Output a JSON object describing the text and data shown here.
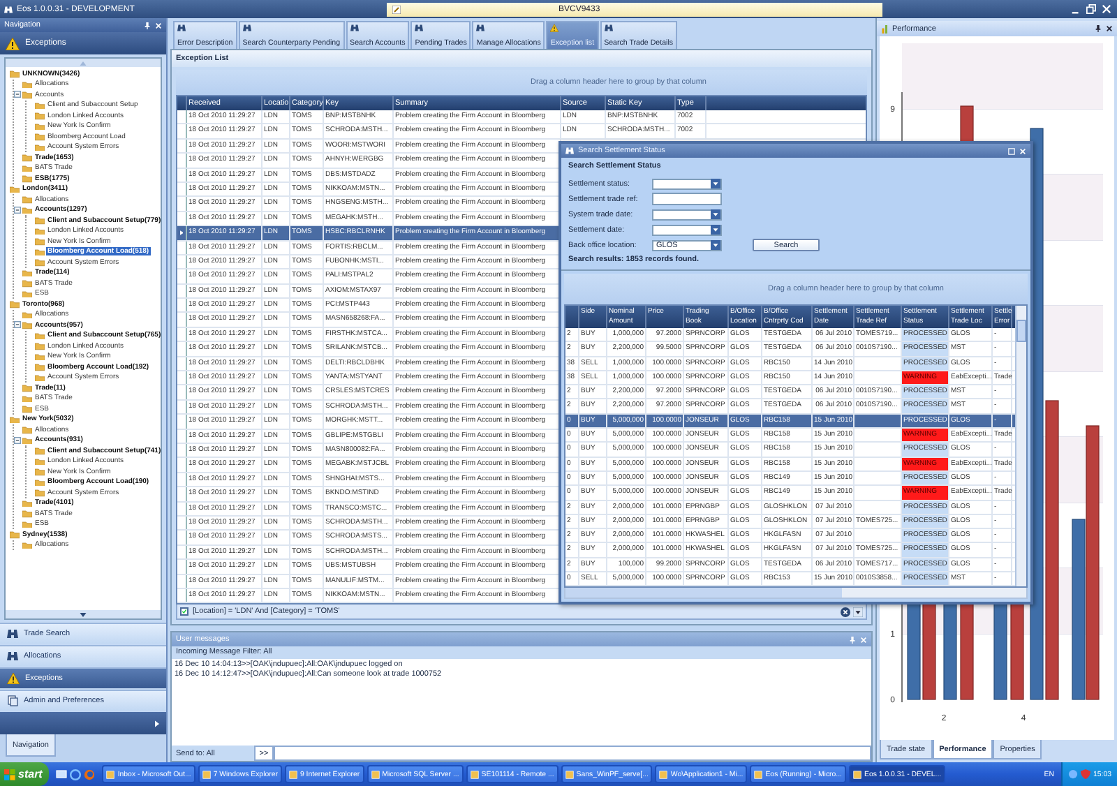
{
  "window": {
    "title": "Eos 1.0.0.31 - DEVELOPMENT",
    "field_value": "BVCV9433"
  },
  "navigation": {
    "title": "Navigation",
    "section": "Exceptions",
    "tree": [
      {
        "label": "UNKNOWN(3426)",
        "bold": true,
        "selected": false,
        "children": [
          {
            "label": "Allocations",
            "bold": false,
            "selected": false
          },
          {
            "label": "Accounts",
            "bold": false,
            "selected": false,
            "expanded": true,
            "children": [
              {
                "label": "Client and Subaccount Setup",
                "bold": false,
                "selected": false
              },
              {
                "label": "London Linked Accounts",
                "bold": false,
                "selected": false
              },
              {
                "label": "New York Is Confirm",
                "bold": false,
                "selected": false
              },
              {
                "label": "Bloomberg Account Load",
                "bold": false,
                "selected": false
              },
              {
                "label": "Account System Errors",
                "bold": false,
                "selected": false
              }
            ]
          },
          {
            "label": "Trade(1653)",
            "bold": true,
            "selected": false
          },
          {
            "label": "BATS Trade",
            "bold": false,
            "selected": false
          },
          {
            "label": "ESB(1775)",
            "bold": true,
            "selected": false
          }
        ]
      },
      {
        "label": "London(3411)",
        "bold": true,
        "selected": false,
        "children": [
          {
            "label": "Allocations",
            "bold": false,
            "selected": false
          },
          {
            "label": "Accounts(1297)",
            "bold": true,
            "selected": false,
            "expanded": true,
            "children": [
              {
                "label": "Client and Subaccount Setup(779)",
                "bold": true,
                "selected": false
              },
              {
                "label": "London Linked Accounts",
                "bold": false,
                "selected": false
              },
              {
                "label": "New York Is Confirm",
                "bold": false,
                "selected": false
              },
              {
                "label": "Bloomberg Account Load(518)",
                "bold": true,
                "selected": true
              },
              {
                "label": "Account System Errors",
                "bold": false,
                "selected": false
              }
            ]
          },
          {
            "label": "Trade(114)",
            "bold": true,
            "selected": false
          },
          {
            "label": "BATS Trade",
            "bold": false,
            "selected": false
          },
          {
            "label": "ESB",
            "bold": false,
            "selected": false
          }
        ]
      },
      {
        "label": "Toronto(968)",
        "bold": true,
        "selected": false,
        "children": [
          {
            "label": "Allocations",
            "bold": false,
            "selected": false
          },
          {
            "label": "Accounts(957)",
            "bold": true,
            "selected": false,
            "expanded": true,
            "children": [
              {
                "label": "Client and Subaccount Setup(765)",
                "bold": true,
                "selected": false
              },
              {
                "label": "London Linked Accounts",
                "bold": false,
                "selected": false
              },
              {
                "label": "New York Is Confirm",
                "bold": false,
                "selected": false
              },
              {
                "label": "Bloomberg Account Load(192)",
                "bold": true,
                "selected": false
              },
              {
                "label": "Account System Errors",
                "bold": false,
                "selected": false
              }
            ]
          },
          {
            "label": "Trade(11)",
            "bold": true,
            "selected": false
          },
          {
            "label": "BATS Trade",
            "bold": false,
            "selected": false
          },
          {
            "label": "ESB",
            "bold": false,
            "selected": false
          }
        ]
      },
      {
        "label": "New York(5032)",
        "bold": true,
        "selected": false,
        "children": [
          {
            "label": "Allocations",
            "bold": false,
            "selected": false
          },
          {
            "label": "Accounts(931)",
            "bold": true,
            "selected": false,
            "expanded": true,
            "children": [
              {
                "label": "Client and Subaccount Setup(741)",
                "bold": true,
                "selected": false
              },
              {
                "label": "London Linked Accounts",
                "bold": false,
                "selected": false
              },
              {
                "label": "New York Is Confirm",
                "bold": false,
                "selected": false
              },
              {
                "label": "Bloomberg Account Load(190)",
                "bold": true,
                "selected": false
              },
              {
                "label": "Account System Errors",
                "bold": false,
                "selected": false
              }
            ]
          },
          {
            "label": "Trade(4101)",
            "bold": true,
            "selected": false
          },
          {
            "label": "BATS Trade",
            "bold": false,
            "selected": false
          },
          {
            "label": "ESB",
            "bold": false,
            "selected": false
          }
        ]
      },
      {
        "label": "Sydney(1538)",
        "bold": true,
        "selected": false,
        "children": [
          {
            "label": "Allocations",
            "bold": false,
            "selected": false
          }
        ]
      }
    ],
    "buttons": [
      {
        "label": "Trade Search",
        "kind": "search",
        "selected": false
      },
      {
        "label": "Allocations",
        "kind": "search",
        "selected": false
      },
      {
        "label": "Exceptions",
        "kind": "warning",
        "selected": true
      },
      {
        "label": "Admin and Preferences",
        "kind": "admin",
        "selected": false
      }
    ],
    "tab": "Navigation"
  },
  "tabs": [
    {
      "label": "Error Description",
      "selected": false
    },
    {
      "label": "Search Counterparty Pending",
      "selected": false
    },
    {
      "label": "Search Accounts",
      "selected": false
    },
    {
      "label": "Pending Trades",
      "selected": false
    },
    {
      "label": "Manage Allocations",
      "selected": false
    },
    {
      "label": "Exception list",
      "selected": true
    },
    {
      "label": "Search Trade Details",
      "selected": false
    }
  ],
  "exception_list": {
    "title": "Exception List",
    "group_hint": "Drag a column header here to group by that column",
    "columns": [
      "Received",
      "Locatio",
      "Category",
      "Key",
      "Summary",
      "Source",
      "Static Key",
      "Type"
    ],
    "rows": [
      {
        "cells": [
          "18 Oct 2010 11:29:27",
          "LDN",
          "TOMS",
          "BNP:MSTBNHK",
          "Problem creating the Firm Account in Bloomberg",
          "LDN",
          "BNP:MSTBNHK",
          "7002"
        ],
        "selected": false
      },
      {
        "cells": [
          "18 Oct 2010 11:29:27",
          "LDN",
          "TOMS",
          "SCHRODA:MSTH...",
          "Problem creating the Firm Account in Bloomberg",
          "LDN",
          "SCHRODA:MSTH...",
          "7002"
        ],
        "selected": false
      },
      {
        "cells": [
          "18 Oct 2010 11:29:27",
          "LDN",
          "TOMS",
          "WOORI:MSTWORI",
          "Problem creating the Firm Account in Bloomberg"
        ],
        "selected": false
      },
      {
        "cells": [
          "18 Oct 2010 11:29:27",
          "LDN",
          "TOMS",
          "AHNYH:WERGBG",
          "Problem creating the Firm Account in Bloomberg"
        ],
        "selected": false
      },
      {
        "cells": [
          "18 Oct 2010 11:29:27",
          "LDN",
          "TOMS",
          "DBS:MSTDADZ",
          "Problem creating the Firm Account in Bloomberg"
        ],
        "selected": false
      },
      {
        "cells": [
          "18 Oct 2010 11:29:27",
          "LDN",
          "TOMS",
          "NIKKOAM:MSTN...",
          "Problem creating the Firm Account in Bloomberg"
        ],
        "selected": false
      },
      {
        "cells": [
          "18 Oct 2010 11:29:27",
          "LDN",
          "TOMS",
          "HNGSENG:MSTH...",
          "Problem creating the Firm Account in Bloomberg"
        ],
        "selected": false
      },
      {
        "cells": [
          "18 Oct 2010 11:29:27",
          "LDN",
          "TOMS",
          "MEGAHK:MSTH...",
          "Problem creating the Firm Account in Bloomberg"
        ],
        "selected": false
      },
      {
        "cells": [
          "18 Oct 2010 11:29:27",
          "LDN",
          "TOMS",
          "HSBC:RBCLRNHK",
          "Problem creating the Firm Account in Bloomberg"
        ],
        "selected": true
      },
      {
        "cells": [
          "18 Oct 2010 11:29:27",
          "LDN",
          "TOMS",
          "FORTIS:RBCLM...",
          "Problem creating the Firm Account in Bloomberg"
        ],
        "selected": false
      },
      {
        "cells": [
          "18 Oct 2010 11:29:27",
          "LDN",
          "TOMS",
          "FUBONHK:MSTI...",
          "Problem creating the Firm Account in Bloomberg"
        ],
        "selected": false
      },
      {
        "cells": [
          "18 Oct 2010 11:29:27",
          "LDN",
          "TOMS",
          "PALI:MSTPAL2",
          "Problem creating the Firm Account in Bloomberg"
        ],
        "selected": false
      },
      {
        "cells": [
          "18 Oct 2010 11:29:27",
          "LDN",
          "TOMS",
          "AXIOM:MSTAX97",
          "Problem creating the Firm Account in Bloomberg"
        ],
        "selected": false
      },
      {
        "cells": [
          "18 Oct 2010 11:29:27",
          "LDN",
          "TOMS",
          "PCI:MSTP443",
          "Problem creating the Firm Account in Bloomberg"
        ],
        "selected": false
      },
      {
        "cells": [
          "18 Oct 2010 11:29:27",
          "LDN",
          "TOMS",
          "MASN658268:FA...",
          "Problem creating the Firm Account in Bloomberg"
        ],
        "selected": false
      },
      {
        "cells": [
          "18 Oct 2010 11:29:27",
          "LDN",
          "TOMS",
          "FIRSTHK:MSTCA...",
          "Problem creating the Firm Account in Bloomberg"
        ],
        "selected": false
      },
      {
        "cells": [
          "18 Oct 2010 11:29:27",
          "LDN",
          "TOMS",
          "SRILANK:MSTCB...",
          "Problem creating the Firm Account in Bloomberg"
        ],
        "selected": false
      },
      {
        "cells": [
          "18 Oct 2010 11:29:27",
          "LDN",
          "TOMS",
          "DELTI:RBCLDBHK",
          "Problem creating the Firm Account in Bloomberg"
        ],
        "selected": false
      },
      {
        "cells": [
          "18 Oct 2010 11:29:27",
          "LDN",
          "TOMS",
          "YANTA:MSTYANT",
          "Problem creating the Firm Account in Bloomberg"
        ],
        "selected": false
      },
      {
        "cells": [
          "18 Oct 2010 11:29:27",
          "LDN",
          "TOMS",
          "CRSLES:MSTCRES",
          "Problem creating the Firm Account in Bloomberg"
        ],
        "selected": false
      },
      {
        "cells": [
          "18 Oct 2010 11:29:27",
          "LDN",
          "TOMS",
          "SCHRODA:MSTH...",
          "Problem creating the Firm Account in Bloomberg"
        ],
        "selected": false
      },
      {
        "cells": [
          "18 Oct 2010 11:29:27",
          "LDN",
          "TOMS",
          "MORGHK:MSTT...",
          "Problem creating the Firm Account in Bloomberg"
        ],
        "selected": false
      },
      {
        "cells": [
          "18 Oct 2010 11:29:27",
          "LDN",
          "TOMS",
          "GBLIPE:MSTGBLI",
          "Problem creating the Firm Account in Bloomberg"
        ],
        "selected": false
      },
      {
        "cells": [
          "18 Oct 2010 11:29:27",
          "LDN",
          "TOMS",
          "MASN800082:FA...",
          "Problem creating the Firm Account in Bloomberg"
        ],
        "selected": false
      },
      {
        "cells": [
          "18 Oct 2010 11:29:27",
          "LDN",
          "TOMS",
          "MEGABK:MSTJCBL",
          "Problem creating the Firm Account in Bloomberg"
        ],
        "selected": false
      },
      {
        "cells": [
          "18 Oct 2010 11:29:27",
          "LDN",
          "TOMS",
          "SHNGHAI:MSTS...",
          "Problem creating the Firm Account in Bloomberg"
        ],
        "selected": false
      },
      {
        "cells": [
          "18 Oct 2010 11:29:27",
          "LDN",
          "TOMS",
          "BKNDO:MSTIND",
          "Problem creating the Firm Account in Bloomberg"
        ],
        "selected": false
      },
      {
        "cells": [
          "18 Oct 2010 11:29:27",
          "LDN",
          "TOMS",
          "TRANSCO:MSTC...",
          "Problem creating the Firm Account in Bloomberg"
        ],
        "selected": false
      },
      {
        "cells": [
          "18 Oct 2010 11:29:27",
          "LDN",
          "TOMS",
          "SCHRODA:MSTH...",
          "Problem creating the Firm Account in Bloomberg"
        ],
        "selected": false
      },
      {
        "cells": [
          "18 Oct 2010 11:29:27",
          "LDN",
          "TOMS",
          "SCHRODA:MSTS...",
          "Problem creating the Firm Account in Bloomberg"
        ],
        "selected": false
      },
      {
        "cells": [
          "18 Oct 2010 11:29:27",
          "LDN",
          "TOMS",
          "SCHRODA:MSTH...",
          "Problem creating the Firm Account in Bloomberg"
        ],
        "selected": false
      },
      {
        "cells": [
          "18 Oct 2010 11:29:27",
          "LDN",
          "TOMS",
          "UBS:MSTUBSH",
          "Problem creating the Firm Account in Bloomberg"
        ],
        "selected": false
      },
      {
        "cells": [
          "18 Oct 2010 11:29:27",
          "LDN",
          "TOMS",
          "MANULIF:MSTM...",
          "Problem creating the Firm Account in Bloomberg"
        ],
        "selected": false
      },
      {
        "cells": [
          "18 Oct 2010 11:29:27",
          "LDN",
          "TOMS",
          "NIKKOAM:MSTN...",
          "Problem creating the Firm Account in Bloomberg"
        ],
        "selected": false
      }
    ],
    "filter": {
      "checked": true,
      "text": "[Location] = 'LDN' And [Category] = 'TOMS'"
    }
  },
  "search_dialog": {
    "title": "Search Settlement Status",
    "heading": "Search Settlement Status",
    "fields": [
      {
        "label": "Settlement status:",
        "kind": "dropdown"
      },
      {
        "label": "Settlement trade ref:",
        "kind": "text"
      },
      {
        "label": "System trade date:",
        "kind": "dropdown"
      },
      {
        "label": "Settlement date:",
        "kind": "dropdown"
      },
      {
        "label": "Back office location:",
        "kind": "dropdown",
        "value": "GLOS"
      }
    ],
    "search_button": "Search",
    "results": "Search results: 1853 records found.",
    "group_hint": "Drag a column header here to group by that column",
    "columns": [
      "",
      "Side",
      "Nominal Amount",
      "Price",
      "Trading Book",
      "B/Office Location",
      "B/Office Cntrprty Cod",
      "Settlement Date",
      "Settlement Trade Ref",
      "Settlement Status",
      "Settlement Trade Loc",
      "Settle Error"
    ],
    "rows": [
      {
        "cells": [
          "2",
          "BUY",
          "1,000,000",
          "97.2000",
          "SPRNCORP",
          "GLOS",
          "TESTGEDA",
          "06 Jul 2010",
          "TOMES719...",
          "PROCESSED",
          "GLOS",
          "-"
        ],
        "warning": false,
        "selected": false
      },
      {
        "cells": [
          "2",
          "BUY",
          "2,200,000",
          "99.5000",
          "SPRNCORP",
          "GLOS",
          "TESTGEDA",
          "06 Jul 2010",
          "0010S7190...",
          "PROCESSED",
          "MST",
          "-"
        ],
        "warning": false,
        "selected": false
      },
      {
        "cells": [
          "38",
          "SELL",
          "1,000,000",
          "100.0000",
          "SPRNCORP",
          "GLOS",
          "RBC150",
          "14 Jun 2010",
          "",
          "PROCESSED",
          "GLOS",
          "-"
        ],
        "warning": false,
        "selected": false
      },
      {
        "cells": [
          "38",
          "SELL",
          "1,000,000",
          "100.0000",
          "SPRNCORP",
          "GLOS",
          "RBC150",
          "14 Jun 2010",
          "",
          "WARNING",
          "EabExcepti...",
          "Trade"
        ],
        "warning": true,
        "selected": false
      },
      {
        "cells": [
          "2",
          "BUY",
          "2,200,000",
          "97.2000",
          "SPRNCORP",
          "GLOS",
          "TESTGEDA",
          "06 Jul 2010",
          "0010S7190...",
          "PROCESSED",
          "MST",
          "-"
        ],
        "warning": false,
        "selected": false
      },
      {
        "cells": [
          "2",
          "BUY",
          "2,200,000",
          "97.2000",
          "SPRNCORP",
          "GLOS",
          "TESTGEDA",
          "06 Jul 2010",
          "0010S7190...",
          "PROCESSED",
          "MST",
          "-"
        ],
        "warning": false,
        "selected": false
      },
      {
        "cells": [
          "0",
          "BUY",
          "5,000,000",
          "100.0000",
          "JONSEUR",
          "GLOS",
          "RBC158",
          "15 Jun 2010",
          "",
          "PROCESSED",
          "GLOS",
          "-"
        ],
        "warning": false,
        "selected": true
      },
      {
        "cells": [
          "0",
          "BUY",
          "5,000,000",
          "100.0000",
          "JONSEUR",
          "GLOS",
          "RBC158",
          "15 Jun 2010",
          "",
          "WARNING",
          "EabExcepti...",
          "Trade"
        ],
        "warning": true,
        "selected": false
      },
      {
        "cells": [
          "0",
          "BUY",
          "5,000,000",
          "100.0000",
          "JONSEUR",
          "GLOS",
          "RBC158",
          "15 Jun 2010",
          "",
          "PROCESSED",
          "GLOS",
          "-"
        ],
        "warning": false,
        "selected": false
      },
      {
        "cells": [
          "0",
          "BUY",
          "5,000,000",
          "100.0000",
          "JONSEUR",
          "GLOS",
          "RBC158",
          "15 Jun 2010",
          "",
          "WARNING",
          "EabExcepti...",
          "Trade"
        ],
        "warning": true,
        "selected": false
      },
      {
        "cells": [
          "0",
          "BUY",
          "5,000,000",
          "100.0000",
          "JONSEUR",
          "GLOS",
          "RBC149",
          "15 Jun 2010",
          "",
          "PROCESSED",
          "GLOS",
          "-"
        ],
        "warning": false,
        "selected": false
      },
      {
        "cells": [
          "0",
          "BUY",
          "5,000,000",
          "100.0000",
          "JONSEUR",
          "GLOS",
          "RBC149",
          "15 Jun 2010",
          "",
          "WARNING",
          "EabExcepti...",
          "Trade"
        ],
        "warning": true,
        "selected": false
      },
      {
        "cells": [
          "2",
          "BUY",
          "2,000,000",
          "101.0000",
          "EPRNGBP",
          "GLOS",
          "GLOSHKLON",
          "07 Jul 2010",
          "",
          "PROCESSED",
          "GLOS",
          "-"
        ],
        "warning": false,
        "selected": false
      },
      {
        "cells": [
          "2",
          "BUY",
          "2,000,000",
          "101.0000",
          "EPRNGBP",
          "GLOS",
          "GLOSHKLON",
          "07 Jul 2010",
          "TOMES725...",
          "PROCESSED",
          "GLOS",
          "-"
        ],
        "warning": false,
        "selected": false
      },
      {
        "cells": [
          "2",
          "BUY",
          "2,000,000",
          "101.0000",
          "HKWASHEL",
          "GLOS",
          "HKGLFASN",
          "07 Jul 2010",
          "",
          "PROCESSED",
          "GLOS",
          "-"
        ],
        "warning": false,
        "selected": false
      },
      {
        "cells": [
          "2",
          "BUY",
          "2,000,000",
          "101.0000",
          "HKWASHEL",
          "GLOS",
          "HKGLFASN",
          "07 Jul 2010",
          "TOMES725...",
          "PROCESSED",
          "GLOS",
          "-"
        ],
        "warning": false,
        "selected": false
      },
      {
        "cells": [
          "2",
          "BUY",
          "100,000",
          "99.2000",
          "SPRNCORP",
          "GLOS",
          "TESTGEDA",
          "06 Jul 2010",
          "TOMES717...",
          "PROCESSED",
          "GLOS",
          "-"
        ],
        "warning": false,
        "selected": false
      },
      {
        "cells": [
          "0",
          "SELL",
          "5,000,000",
          "100.0000",
          "SPRNCORP",
          "GLOS",
          "RBC153",
          "15 Jun 2010",
          "0010S3858...",
          "PROCESSED",
          "MST",
          "-"
        ],
        "warning": false,
        "selected": false
      }
    ]
  },
  "user_messages": {
    "title": "User messages",
    "filter": "Incoming Message Filter: All",
    "messages": [
      "16 Dec 10 14:04:13>>[OAK\\jndupuec]:All:OAK\\jndupuec logged on",
      "16 Dec 10 14:12:47>>[OAK\\jndupuec]:All:Can someone look at trade 1000752"
    ],
    "send_to": "Send to: All",
    "send_button": ">>"
  },
  "performance": {
    "title": "Performance",
    "y_labels": [
      "9",
      "1",
      "0"
    ],
    "x_labels": [
      "2",
      "4"
    ],
    "tabs": [
      {
        "label": "Trade state",
        "selected": false
      },
      {
        "label": "Performance",
        "selected": true
      },
      {
        "label": "Properties",
        "selected": false
      }
    ]
  },
  "taskbar": {
    "start": "start",
    "items": [
      {
        "label": "Inbox - Microsoft Out...",
        "selected": false
      },
      {
        "label": "7 Windows Explorer",
        "selected": false
      },
      {
        "label": "9 Internet Explorer",
        "selected": false
      },
      {
        "label": "Microsoft SQL Server ...",
        "selected": false
      },
      {
        "label": "SE101114 - Remote ...",
        "selected": false
      },
      {
        "label": "Sans_WinPF_serve[...",
        "selected": false
      },
      {
        "label": "Wo\\Application1 - Mi...",
        "selected": false
      },
      {
        "label": "Eos (Running) - Micro...",
        "selected": false
      },
      {
        "label": "Eos 1.0.0.31 - DEVEL...",
        "selected": true
      }
    ],
    "language": "EN",
    "clock": "15:03"
  }
}
